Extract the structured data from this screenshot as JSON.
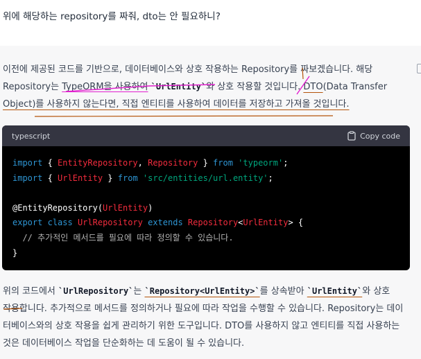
{
  "user_message": "위에 해당하는 repository를 짜줘, dto는 안 필요하니?",
  "response": {
    "intro_line1": "이전에 제공된 코드를 기반으로, 데이터베이스와 상호 작용하는 Repository를 짜보겠습니다. 해당",
    "intro_line2_a": "Repository는 ",
    "intro_line2_b": "TypeORM을 사용하여",
    "intro_line2_c": " ",
    "intro_line2_code": "`UrlEntity`",
    "intro_line2_d": "와 상호 작용할 것입니다. ",
    "intro_line2_e": "DTO",
    "intro_line2_f": "(Data Transfer",
    "intro_line3_a": "Object)",
    "intro_line3_b": "를 사용하지 않는다면, 직접 엔티티를 사용하여 데이터를 저장하고 가져올 것입니다.",
    "outro_line1_a": "위의 코드에서 ",
    "outro_line1_code1": "`UrlRepository`",
    "outro_line1_b": "는 ",
    "outro_line1_code2": "`Repository<UrlEntity>`",
    "outro_line1_c": "를 상속받아 ",
    "outro_line1_code3": "`UrlEntity`",
    "outro_line1_d": "와 상호",
    "outro_line2": "작용합니다. 추가적으로 메서드를 정의하거나 필요에 따라 작업을 수행할 수 있습니다. Repository는 데이",
    "outro_line3": "터베이스와의 상호 작용을 쉽게 관리하기 위한 도구입니다. DTO를 사용하지 않고 엔티티를 직접 사용하는",
    "outro_line4": "것은 데이터베이스 작업을 단순화하는 데 도움이 될 수 있습니다."
  },
  "code_block": {
    "language": "typescript",
    "copy_label": "Copy code",
    "copy_icon": "clipboard-icon",
    "line1": {
      "kw1": "import",
      "p1": " { ",
      "c1": "EntityRepository",
      "p2": ", ",
      "c2": "Repository",
      "p3": " } ",
      "kw2": "from",
      "p4": " ",
      "s1": "'typeorm'",
      "p5": ";"
    },
    "line2": {
      "kw1": "import",
      "p1": " { ",
      "c1": "UrlEntity",
      "p2": " } ",
      "kw2": "from",
      "p3": " ",
      "s1": "'src/entities/url.entity'",
      "p4": ";"
    },
    "line4": {
      "p1": "@EntityRepository(",
      "c1": "UrlEntity",
      "p2": ")"
    },
    "line5": {
      "kw1": "export",
      "p1": " ",
      "kw2": "class",
      "p2": " ",
      "c1": "UrlRepository",
      "p3": " ",
      "kw3": "extends",
      "p4": " ",
      "c2": "Repository",
      "p5": "<",
      "c3": "UrlEntity",
      "p6": "> {"
    },
    "line6": "  // 추가적인 메서드를 필요에 따라 정의할 수 있습니다.",
    "line7": "}"
  },
  "colors": {
    "keyword": "#2e95d3",
    "class_name": "#f22c3d",
    "string": "#00a67d",
    "annotation_pink": "#e11dce",
    "annotation_orange": "#b45309"
  }
}
